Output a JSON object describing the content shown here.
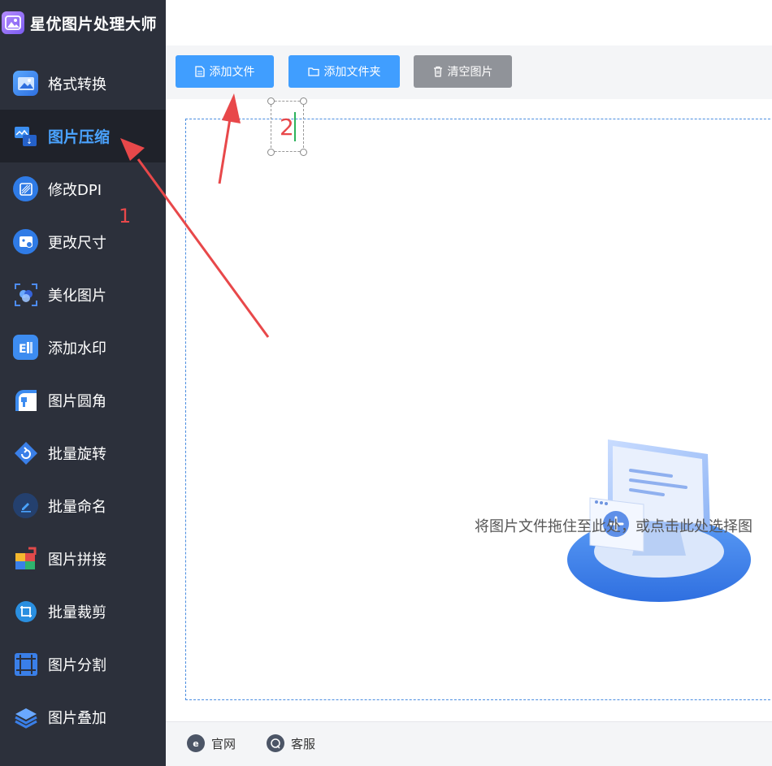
{
  "app": {
    "title": "星优图片处理大师"
  },
  "sidebar": {
    "items": [
      {
        "label": "格式转换",
        "icon": "format-convert-icon",
        "active": false
      },
      {
        "label": "图片压缩",
        "icon": "image-compress-icon",
        "active": true
      },
      {
        "label": "修改DPI",
        "icon": "dpi-icon",
        "active": false
      },
      {
        "label": "更改尺寸",
        "icon": "resize-icon",
        "active": false
      },
      {
        "label": "美化图片",
        "icon": "beautify-icon",
        "active": false
      },
      {
        "label": "添加水印",
        "icon": "watermark-icon",
        "active": false
      },
      {
        "label": "图片圆角",
        "icon": "round-corner-icon",
        "active": false
      },
      {
        "label": "批量旋转",
        "icon": "rotate-icon",
        "active": false
      },
      {
        "label": "批量命名",
        "icon": "rename-icon",
        "active": false
      },
      {
        "label": "图片拼接",
        "icon": "stitch-icon",
        "active": false
      },
      {
        "label": "批量裁剪",
        "icon": "crop-icon",
        "active": false
      },
      {
        "label": "图片分割",
        "icon": "split-icon",
        "active": false
      },
      {
        "label": "图片叠加",
        "icon": "overlay-icon",
        "active": false
      }
    ]
  },
  "toolbar": {
    "add_file": "添加文件",
    "add_folder": "添加文件夹",
    "clear_images": "清空图片"
  },
  "dropzone": {
    "hint": "将图片文件拖住至此处，或点击此处选择图"
  },
  "footer": {
    "website": "官网",
    "support": "客服"
  },
  "annotations": {
    "step1": "1",
    "step2": "2"
  },
  "colors": {
    "sidebar_bg": "#2c303b",
    "active_bg": "#1f222a",
    "accent": "#409eff",
    "gray_button": "#909399",
    "annotation_red": "#e8484a"
  }
}
